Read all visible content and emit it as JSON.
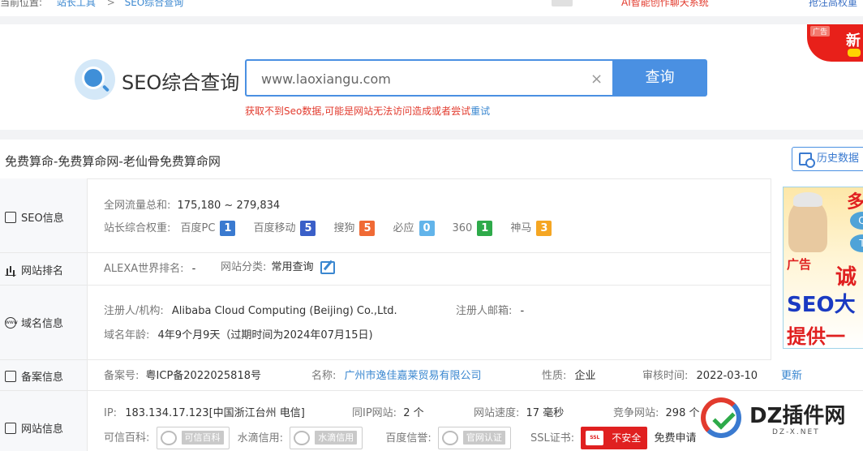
{
  "topbar": {
    "location_label": "当前位置:",
    "breadcrumb_tools": "站长工具",
    "breadcrumb_sep": ">",
    "breadcrumb_current": "SEO综合查询",
    "ai_ad": "AI智能创作聊天系统",
    "right_link": "抢注高权重"
  },
  "search": {
    "title": "SEO综合查询",
    "input_value": "www.laoxiangu.com",
    "clear_icon": "×",
    "button_label": "查询",
    "error_text": "获取不到Seo数据,可能是网站无法访问造成或者尝试",
    "retry_link": "重试"
  },
  "badge_ad": {
    "tag": "广告",
    "text": "新"
  },
  "site": {
    "title": "免费算命-免费算命网-老仙骨免费算命网",
    "history_button": "历史数据"
  },
  "sections": {
    "seo": "SEO信息",
    "rank": "网站排名",
    "domain": "域名信息",
    "icp": "备案信息",
    "site_info": "网站信息"
  },
  "seo_info": {
    "traffic_label": "全网流量总和:",
    "traffic_value": "175,180 ~ 279,834",
    "weight_label": "站长综合权重:",
    "weights": [
      {
        "name": "百度PC",
        "value": "1",
        "color": "#3a7ad0"
      },
      {
        "name": "百度移动",
        "value": "5",
        "color": "#3a5fc8"
      },
      {
        "name": "搜狗",
        "value": "5",
        "color": "#f06a35"
      },
      {
        "name": "必应",
        "value": "0",
        "color": "#62b4ea"
      },
      {
        "name": "360",
        "value": "1",
        "color": "#2eaa4a"
      },
      {
        "name": "神马",
        "value": "3",
        "color": "#f5a623"
      }
    ]
  },
  "rank_info": {
    "alexa_label": "ALEXA世界排名:",
    "alexa_value": "-",
    "category_label": "网站分类:",
    "category_value": "常用查询"
  },
  "domain_info": {
    "registrar_label": "注册人/机构:",
    "registrar_value": "Alibaba Cloud Computing (Beijing) Co.,Ltd.",
    "email_label": "注册人邮箱:",
    "email_value": "-",
    "age_label": "域名年龄:",
    "age_value": "4年9个月9天（过期时间为2024年07月15日)"
  },
  "icp_info": {
    "number_label": "备案号:",
    "number_value": "粤ICP备2022025818号",
    "name_label": "名称:",
    "name_value": "广州市逸佳嘉莱贸易有限公司",
    "type_label": "性质:",
    "type_value": "企业",
    "date_label": "审核时间:",
    "date_value": "2022-03-10",
    "update_link": "更新"
  },
  "site_info": {
    "ip_label": "IP:",
    "ip_value": "183.134.17.123[中国浙江台州 电信]",
    "same_ip_label": "同IP网站:",
    "same_ip_value": "2 个",
    "speed_label": "网站速度:",
    "speed_value": "17 毫秒",
    "competitor_label": "竞争网站:",
    "competitor_value": "298 个",
    "baike_label": "可信百科:",
    "baike_cert": "可信百科",
    "shuidi_label": "水滴信用:",
    "shuidi_cert": "水滴信用",
    "baidu_label": "百度信誉:",
    "baidu_cert": "官网认证",
    "ssl_label": "SSL证书:",
    "ssl_badge": "不安全",
    "ssl_icon_text": "SSL",
    "ssl_apply": "免费申请"
  },
  "right_ad": {
    "duo": "多",
    "q": "Q",
    "t": "T",
    "label": "广告",
    "cheng": "诚",
    "seo": "SEO大",
    "tigong": "提供一"
  },
  "watermark": {
    "text": "DZ插件网",
    "sub": "DZ-X.NET"
  }
}
